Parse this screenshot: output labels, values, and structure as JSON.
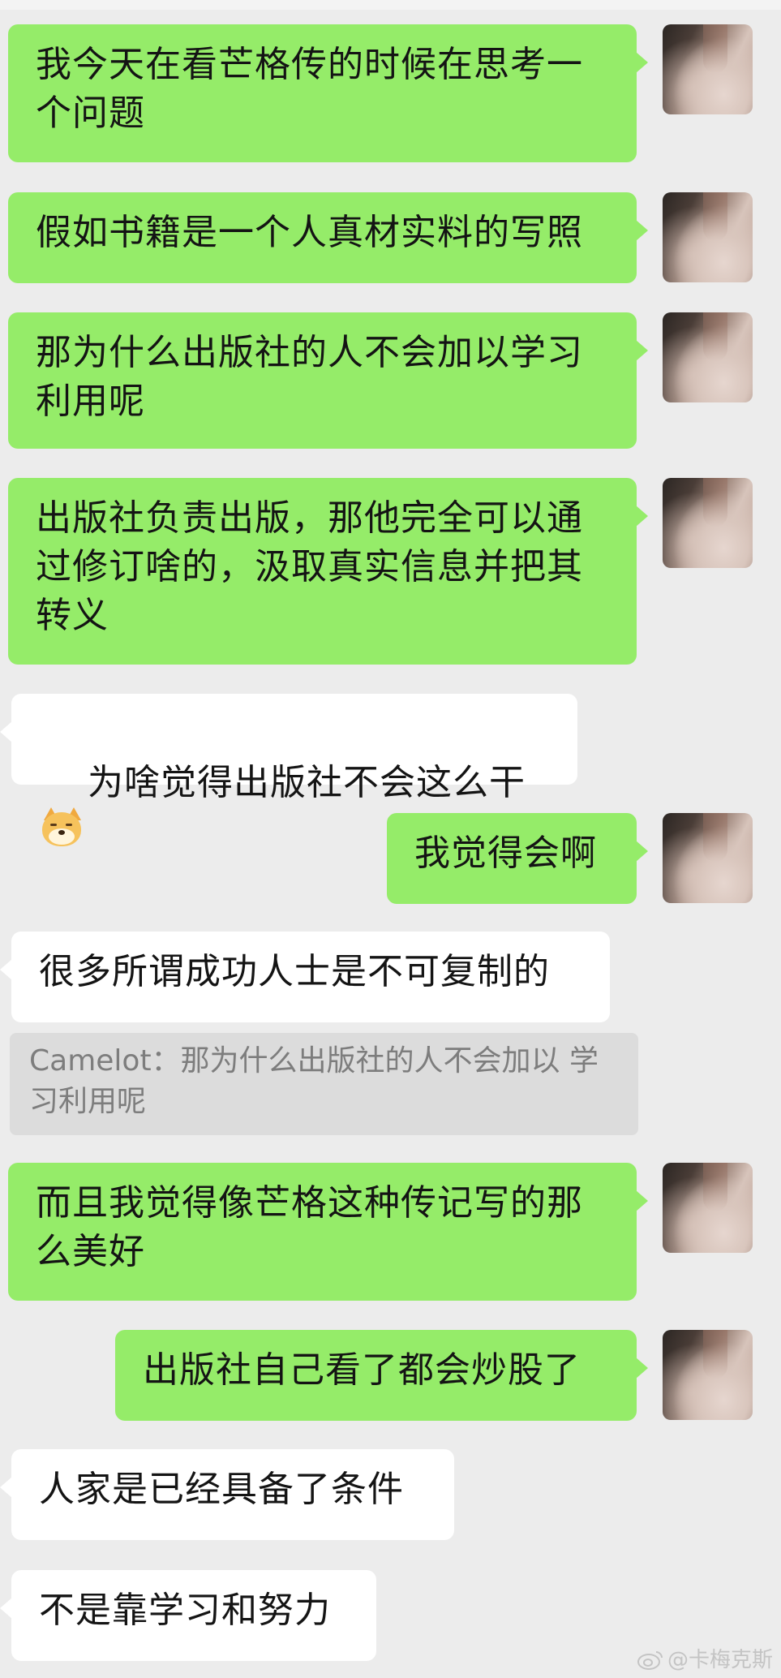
{
  "messages": [
    {
      "side": "me",
      "text": "我今天在看芒格传的时候在思考一\n个问题"
    },
    {
      "side": "me",
      "text": "假如书籍是一个人真材实料的写照"
    },
    {
      "side": "me",
      "text": "那为什么出版社的人不会加以学习\n利用呢"
    },
    {
      "side": "me",
      "text": "出版社负责出版，那他完全可以通\n过修订啥的，汲取真实信息并把其\n转义"
    },
    {
      "side": "them",
      "text": "为啥觉得出版社不会这么干",
      "emoji": "doge-emoji"
    },
    {
      "side": "me",
      "text": "我觉得会啊"
    },
    {
      "side": "them",
      "text": "很多所谓成功人士是不可复制的"
    },
    {
      "quote": "Camelot：那为什么出版社的人不会加以\n学习利用呢"
    },
    {
      "side": "me",
      "text": "而且我觉得像芒格这种传记写的那\n么美好"
    },
    {
      "side": "me",
      "text": "出版社自己看了都会炒股了"
    },
    {
      "side": "them",
      "text": "人家是已经具备了条件"
    },
    {
      "side": "them",
      "text": "不是靠学习和努力"
    }
  ],
  "watermark": "@卡梅克斯",
  "colors": {
    "background": "#ececec",
    "me_bubble": "#95ec69",
    "them_bubble": "#ffffff",
    "quote_bg": "#dcdcdc"
  }
}
